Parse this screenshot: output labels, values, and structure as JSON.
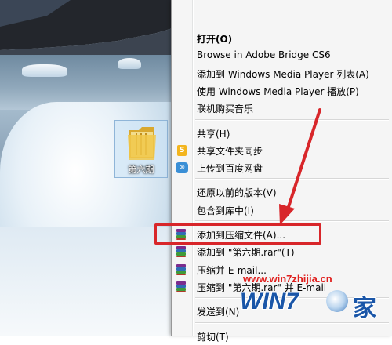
{
  "desktop": {
    "folder": {
      "label": "第六期",
      "icon": "folder-icon"
    }
  },
  "context_menu": {
    "groups": [
      [
        {
          "id": "open",
          "label": "打开(O)",
          "bold": true,
          "icon": null
        },
        {
          "id": "browse-bridge",
          "label": "Browse in Adobe Bridge CS6",
          "icon": null
        },
        {
          "id": "add-wmp-list",
          "label": "添加到 Windows Media Player 列表(A)",
          "icon": null
        },
        {
          "id": "play-wmp",
          "label": "使用 Windows Media Player 播放(P)",
          "icon": null
        },
        {
          "id": "buy-music",
          "label": "联机购买音乐",
          "icon": null
        }
      ],
      [
        {
          "id": "share",
          "label": "共享(H)",
          "icon": null
        },
        {
          "id": "shared-folder-sync",
          "label": "共享文件夹同步",
          "icon": "sync-icon"
        },
        {
          "id": "upload-baidu",
          "label": "上传到百度网盘",
          "icon": "baidu-cloud-icon"
        }
      ],
      [
        {
          "id": "restore-versions",
          "label": "还原以前的版本(V)",
          "icon": null
        },
        {
          "id": "include-library",
          "label": "包含到库中(I)",
          "icon": null
        }
      ],
      [
        {
          "id": "add-to-archive",
          "label": "添加到压缩文件(A)...",
          "icon": "winrar-icon",
          "highlighted": true
        },
        {
          "id": "add-to-rar",
          "label": "添加到 \"第六期.rar\"(T)",
          "icon": "winrar-icon"
        },
        {
          "id": "compress-email",
          "label": "压缩并 E-mail...",
          "icon": "winrar-icon"
        },
        {
          "id": "compress-rar-email",
          "label": "压缩到 \"第六期.rar\" 并 E-mail",
          "icon": "winrar-icon"
        }
      ],
      [
        {
          "id": "send-to",
          "label": "发送到(N)",
          "icon": null
        }
      ],
      [
        {
          "id": "cut",
          "label": "剪切(T)",
          "icon": null
        }
      ]
    ]
  },
  "watermark": {
    "url": "www.win7zhijia.cn",
    "logo": "WIN7",
    "suffix": "家"
  },
  "colors": {
    "highlight_border": "#d8262a",
    "arrow": "#d8262a",
    "watermark_url": "#e0201e",
    "watermark_logo": "#1a56a8"
  }
}
